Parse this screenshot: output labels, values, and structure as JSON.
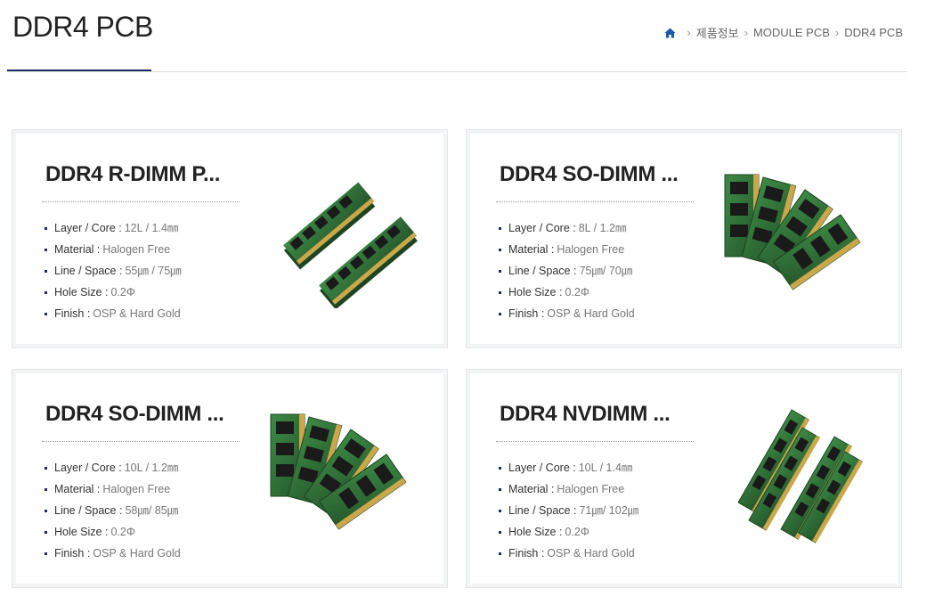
{
  "page": {
    "title": "DDR4 PCB"
  },
  "breadcrumb": {
    "home_icon": "home-icon",
    "items": [
      "제품정보",
      "MODULE PCB",
      "DDR4 PCB"
    ]
  },
  "colors": {
    "accent": "#1c2d5a",
    "pcb_green": "#2e6b34",
    "gold": "#c9a74a"
  },
  "products": [
    {
      "title": "DDR4 R-DIMM P...",
      "specs": [
        {
          "label": "Layer / Core :",
          "value": "12L / 1.4㎜"
        },
        {
          "label": "Material :",
          "value": "Halogen Free"
        },
        {
          "label": "Line / Space :",
          "value": "55㎛ / 75㎛"
        },
        {
          "label": "Hole Size :",
          "value": "0.2Φ"
        },
        {
          "label": "Finish :",
          "value": "OSP & Hard Gold"
        }
      ]
    },
    {
      "title": "DDR4 SO-DIMM ...",
      "specs": [
        {
          "label": "Layer / Core :",
          "value": "8L / 1.2㎜"
        },
        {
          "label": "Material :",
          "value": "Halogen Free"
        },
        {
          "label": "Line / Space :",
          "value": "75㎛/ 70㎛"
        },
        {
          "label": "Hole Size :",
          "value": "0.2Φ"
        },
        {
          "label": "Finish :",
          "value": "OSP & Hard Gold"
        }
      ]
    },
    {
      "title": "DDR4 SO-DIMM ...",
      "specs": [
        {
          "label": "Layer / Core :",
          "value": "10L / 1.2㎜"
        },
        {
          "label": "Material :",
          "value": "Halogen Free"
        },
        {
          "label": "Line / Space :",
          "value": "58㎛/ 85㎛"
        },
        {
          "label": "Hole Size :",
          "value": "0.2Φ"
        },
        {
          "label": "Finish :",
          "value": "OSP & Hard Gold"
        }
      ]
    },
    {
      "title": "DDR4 NVDIMM ...",
      "specs": [
        {
          "label": "Layer / Core :",
          "value": "10L / 1.4㎜"
        },
        {
          "label": "Material :",
          "value": "Halogen Free"
        },
        {
          "label": "Line / Space :",
          "value": "71㎛/ 102㎛"
        },
        {
          "label": "Hole Size :",
          "value": "0.2Φ"
        },
        {
          "label": "Finish :",
          "value": "OSP & Hard Gold"
        }
      ]
    }
  ]
}
